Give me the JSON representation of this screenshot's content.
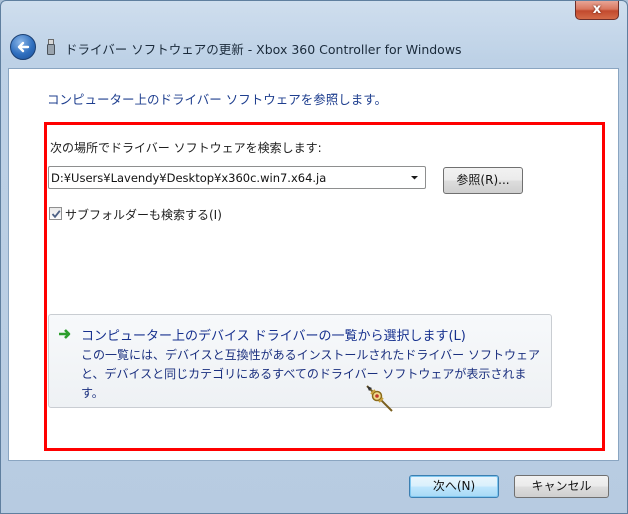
{
  "window": {
    "title": "ドライバー ソフトウェアの更新 - Xbox 360 Controller for Windows",
    "close_label": "x"
  },
  "main": {
    "subtitle": "コンピューター上のドライバー ソフトウェアを参照します。",
    "search_label": "次の場所でドライバー ソフトウェアを検索します:",
    "path_value": "D:¥Users¥Lavendy¥Desktop¥x360c.win7.x64.ja",
    "browse_label": "参照(R)...",
    "subfolder_label": "サブフォルダーも検索する(I)",
    "subfolder_checked": true,
    "pick": {
      "title": "コンピューター上のデバイス ドライバーの一覧から選択します(L)",
      "description": "この一覧には、デバイスと互換性があるインストールされたドライバー ソフトウェアと、デバイスと同じカテゴリにあるすべてのドライバー ソフトウェアが表示されます。"
    }
  },
  "footer": {
    "next_label": "次へ(N)",
    "cancel_label": "キャンセル"
  },
  "icons": {
    "back": "back-arrow-icon",
    "device": "usb-device-icon",
    "dropdown": "chevron-down-icon",
    "check": "check-icon",
    "pick_arrow": "green-arrow-icon",
    "cursor": "busy-cursor-icon"
  },
  "colors": {
    "highlight_border": "#ff0000",
    "link_text": "#16308e",
    "subtitle_text": "#1f3f8f"
  }
}
